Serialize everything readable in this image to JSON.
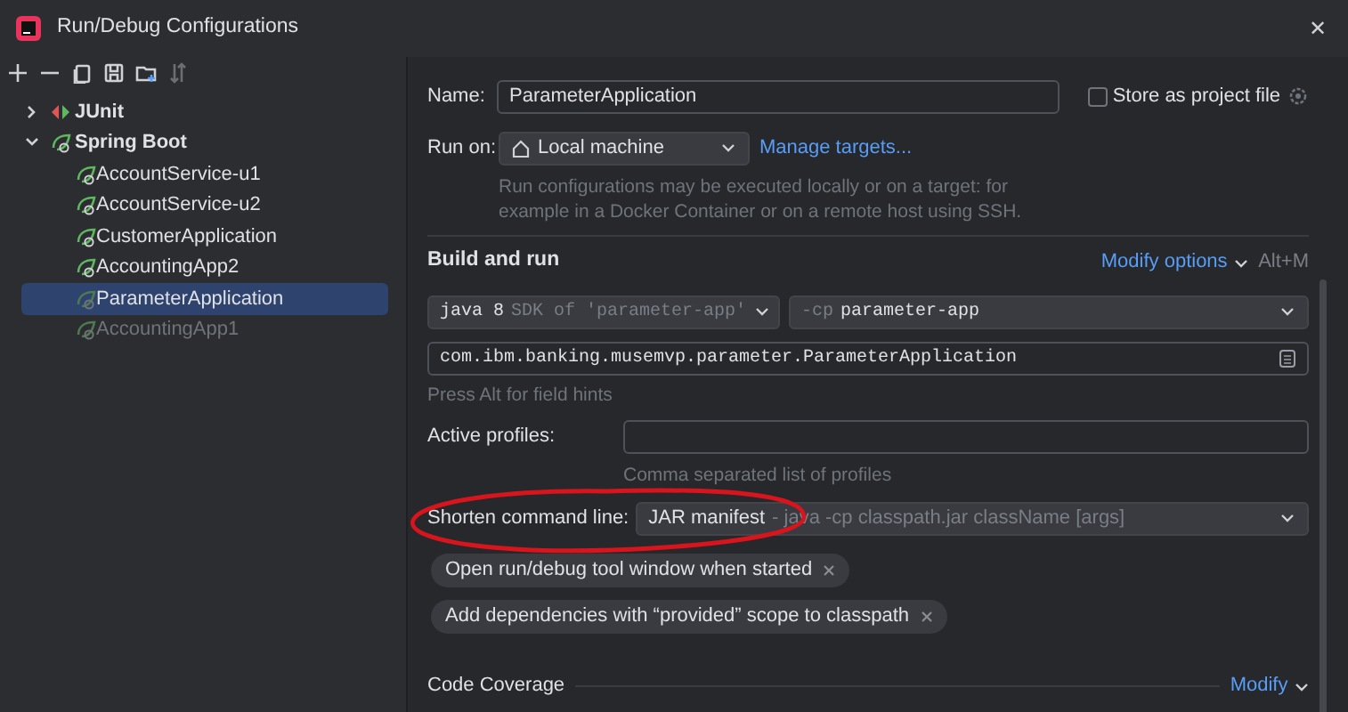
{
  "window": {
    "title": "Run/Debug Configurations",
    "close": "✕"
  },
  "toolbar": [
    {
      "kind": "add"
    },
    {
      "kind": "remove"
    },
    {
      "kind": "copy"
    },
    {
      "kind": "save"
    },
    {
      "kind": "folder"
    },
    {
      "kind": "sort",
      "disabled": true
    }
  ],
  "tree": [
    {
      "label": "JUnit",
      "kind": "junit",
      "expanded": false
    },
    {
      "label": "Spring Boot",
      "kind": "spring",
      "expanded": true,
      "children": [
        {
          "label": "AccountService-u1",
          "selected": false,
          "disabled": false
        },
        {
          "label": "AccountService-u2",
          "selected": false,
          "disabled": false
        },
        {
          "label": "CustomerApplication",
          "selected": false,
          "disabled": false
        },
        {
          "label": "AccountingApp2",
          "selected": false,
          "disabled": false
        },
        {
          "label": "ParameterApplication",
          "selected": true,
          "disabled": false
        },
        {
          "label": "AccountingApp1",
          "selected": false,
          "disabled": true
        }
      ]
    }
  ],
  "name": {
    "label": "Name:",
    "value": "ParameterApplication"
  },
  "store_as_project_file": {
    "label": "Store as project file",
    "checked": false
  },
  "run_on": {
    "label": "Run on:",
    "value": "Local machine",
    "link": "Manage targets...",
    "hint": "Run configurations may be executed locally or on a target: for example in a Docker Container or on a remote host using SSH."
  },
  "build_and_run": {
    "title": "Build and run",
    "modify_options": "Modify options",
    "shortcut": "Alt+M",
    "jre": {
      "value": "java 8",
      "detail": "SDK of 'parameter-app'"
    },
    "classpath": {
      "prefix": "-cp",
      "value": "parameter-app"
    },
    "main_class": "com.ibm.banking.musemvp.parameter.ParameterApplication",
    "field_hint": "Press Alt for field hints"
  },
  "active_profiles": {
    "label": "Active profiles:",
    "hint": "Comma separated list of profiles"
  },
  "shorten_command_line": {
    "label": "Shorten command line:",
    "value": "JAR manifest",
    "detail": "- java -cp classpath.jar className [args]"
  },
  "options": [
    {
      "label": "Open run/debug tool window when started"
    },
    {
      "label": "Add dependencies with “provided” scope to classpath"
    }
  ],
  "code_coverage": {
    "title": "Code Coverage",
    "link": "Modify"
  },
  "annotation": {
    "color": "#d8141c"
  }
}
